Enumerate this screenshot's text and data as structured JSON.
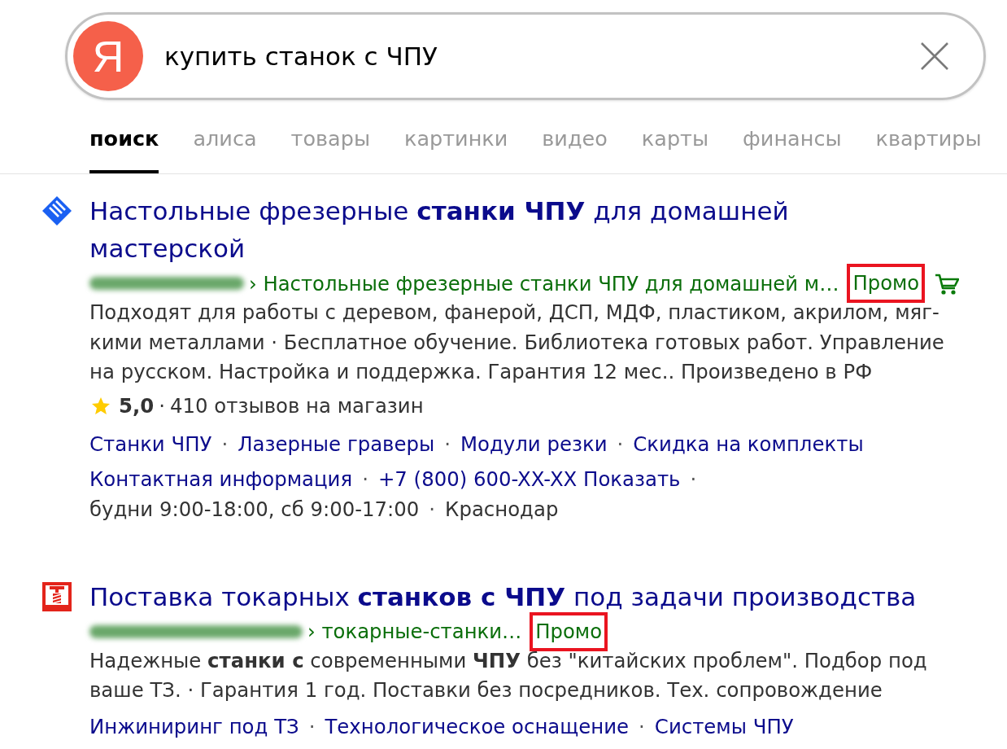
{
  "search": {
    "logo": "Я",
    "value": "купить станок с ЧПУ"
  },
  "tabs": [
    {
      "label": "поиск",
      "selected": true
    },
    {
      "label": "алиса",
      "selected": false
    },
    {
      "label": "товары",
      "selected": false
    },
    {
      "label": "картинки",
      "selected": false
    },
    {
      "label": "видео",
      "selected": false
    },
    {
      "label": "карты",
      "selected": false
    },
    {
      "label": "финансы",
      "selected": false
    },
    {
      "label": "квартиры",
      "selected": false
    }
  ],
  "results": [
    {
      "favicon": {
        "kind": "diamond",
        "color": "#1a60f2"
      },
      "title": "Настольные фрезерные **станки ЧПУ** для домашней мастерской",
      "domain_blurred": true,
      "path": "› Настольные фрезерные станки ЧПУ для домашней м…",
      "promo": {
        "text": "Промо",
        "highlighted": true
      },
      "shop": true,
      "snippet_lines": [
        "Подходят для работы с деревом, фанерой, ДСП, МДФ, пластиком, акрилом, мяг-",
        "кими металлами · Бесплатное обучение. Библиотека готовых работ. Управление",
        "на русском. Настройка и поддержка. Гарантия 12 мес.. Произведено в РФ"
      ],
      "rating": {
        "score": "5,0",
        "separator": "·",
        "reviews": "410 отзывов на магазин"
      },
      "sitelinks": [
        {
          "label": "Станки ЧПУ",
          "separator": "·"
        },
        {
          "label": "Лазерные граверы",
          "separator": "·"
        },
        {
          "label": "Модули резки",
          "separator": "·"
        },
        {
          "label": "Скидка на комплекты"
        }
      ],
      "contacts": [
        {
          "kind": "link",
          "label": "Контактная информация",
          "separator": "·"
        },
        {
          "kind": "link",
          "label": "+7 (800) 600-XX-XX Показать",
          "separator": "·"
        },
        {
          "kind": "text",
          "label": "будни 9:00-18:00, сб 9:00-17:00",
          "separator": "·"
        },
        {
          "kind": "text",
          "label": "Краснодар"
        }
      ]
    },
    {
      "favicon": {
        "kind": "frame",
        "color": "#e3241b"
      },
      "title": "Поставка токарных **станков с ЧПУ** под задачи производства",
      "domain_blurred": true,
      "path": "› токарные-станки…",
      "promo": {
        "text": "Промо",
        "highlighted": true
      },
      "snippet_lines": [
        "Надежные **станки с** современными **ЧПУ** без \"китайских проблем\". Подбор под",
        "ваше ТЗ. · Гарантия 1 год. Поставки без посредников. Тех. сопровождение"
      ],
      "sitelinks": [
        {
          "label": "Инжиниринг под ТЗ",
          "separator": "·"
        },
        {
          "label": "Технологическое оснащение",
          "separator": "·"
        },
        {
          "label": "Системы ЧПУ"
        }
      ]
    }
  ]
}
